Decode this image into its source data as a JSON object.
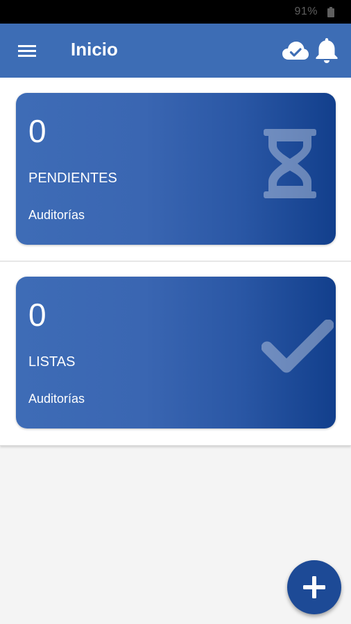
{
  "status_bar": {
    "battery": "91%"
  },
  "app_bar": {
    "title": "Inicio"
  },
  "cards": [
    {
      "count": "0",
      "label": "PENDIENTES",
      "subtitle": "Auditorías",
      "icon": "hourglass-icon"
    },
    {
      "count": "0",
      "label": "LISTAS",
      "subtitle": "Auditorías",
      "icon": "check-icon"
    }
  ],
  "icons": {
    "menu": "menu-icon",
    "cloud": "cloud-check-icon",
    "bell": "bell-icon",
    "fab": "plus-icon"
  },
  "colors": {
    "primary": "#3d6db5",
    "card_start": "#3e6cb6",
    "card_end": "#123f8c",
    "fab": "#1d4a96"
  }
}
